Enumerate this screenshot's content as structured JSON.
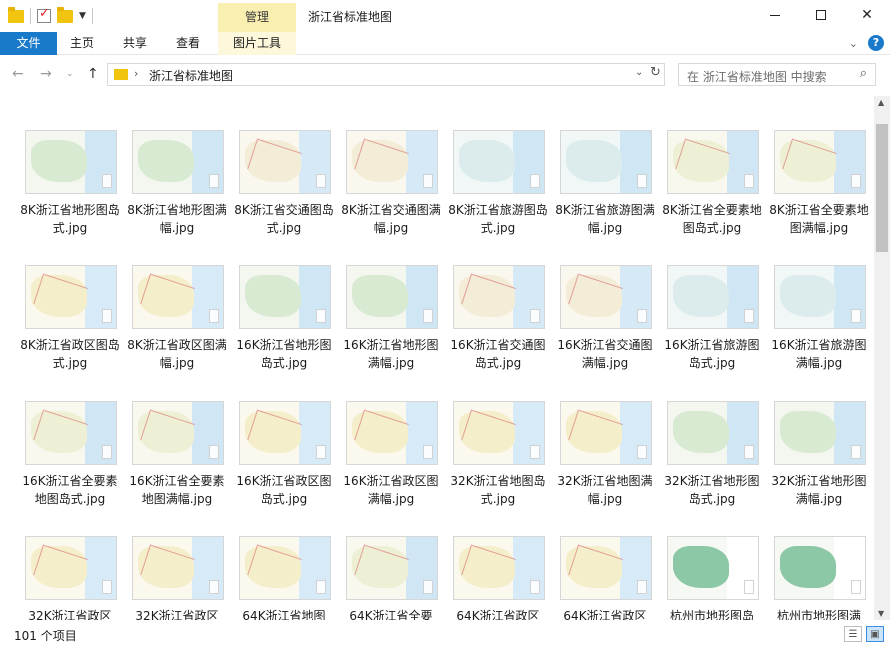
{
  "window": {
    "title": "浙江省标准地图",
    "context_tab": "管理",
    "minimize_icon": "minimize-icon",
    "maximize_icon": "maximize-icon",
    "close_icon": "close-icon"
  },
  "ribbon": {
    "tabs": [
      "文件",
      "主页",
      "共享",
      "查看",
      "图片工具"
    ],
    "help_label": "?"
  },
  "address": {
    "path": "浙江省标准地图",
    "separator": "›",
    "search_placeholder": "在 浙江省标准地图 中搜索"
  },
  "items": [
    {
      "name": "8K浙江省地形图岛式.jpg",
      "style": "terrain"
    },
    {
      "name": "8K浙江省地形图满幅.jpg",
      "style": "terrain"
    },
    {
      "name": "8K浙江省交通图岛式.jpg",
      "style": "traffic"
    },
    {
      "name": "8K浙江省交通图满幅.jpg",
      "style": "traffic"
    },
    {
      "name": "8K浙江省旅游图岛式.jpg",
      "style": "tourism"
    },
    {
      "name": "8K浙江省旅游图满幅.jpg",
      "style": "tourism"
    },
    {
      "name": "8K浙江省全要素地图岛式.jpg",
      "style": "full"
    },
    {
      "name": "8K浙江省全要素地图满幅.jpg",
      "style": "full"
    },
    {
      "name": "8K浙江省政区图岛式.jpg",
      "style": "admin"
    },
    {
      "name": "8K浙江省政区图满幅.jpg",
      "style": "admin"
    },
    {
      "name": "16K浙江省地形图岛式.jpg",
      "style": "terrain"
    },
    {
      "name": "16K浙江省地形图满幅.jpg",
      "style": "terrain"
    },
    {
      "name": "16K浙江省交通图岛式.jpg",
      "style": "traffic"
    },
    {
      "name": "16K浙江省交通图满幅.jpg",
      "style": "traffic"
    },
    {
      "name": "16K浙江省旅游图岛式.jpg",
      "style": "tourism"
    },
    {
      "name": "16K浙江省旅游图满幅.jpg",
      "style": "tourism"
    },
    {
      "name": "16K浙江省全要素地图岛式.jpg",
      "style": "full"
    },
    {
      "name": "16K浙江省全要素地图满幅.jpg",
      "style": "full"
    },
    {
      "name": "16K浙江省政区图岛式.jpg",
      "style": "admin"
    },
    {
      "name": "16K浙江省政区图满幅.jpg",
      "style": "admin"
    },
    {
      "name": "32K浙江省地图岛式.jpg",
      "style": "admin"
    },
    {
      "name": "32K浙江省地图满幅.jpg",
      "style": "admin"
    },
    {
      "name": "32K浙江省地形图岛式.jpg",
      "style": "terrain"
    },
    {
      "name": "32K浙江省地形图满幅.jpg",
      "style": "terrain"
    },
    {
      "name": "32K浙江省政区",
      "style": "admin"
    },
    {
      "name": "32K浙江省政区",
      "style": "admin"
    },
    {
      "name": "64K浙江省地图",
      "style": "admin"
    },
    {
      "name": "64K浙江省全要",
      "style": "full"
    },
    {
      "name": "64K浙江省政区",
      "style": "admin"
    },
    {
      "name": "64K浙江省政区",
      "style": "admin"
    },
    {
      "name": "杭州市地形图岛",
      "style": "hangzhou"
    },
    {
      "name": "杭州市地形图满",
      "style": "hangzhou"
    }
  ],
  "colors": {
    "terrain": {
      "land": "#d9ead3",
      "sea": "#cfe6f5",
      "bg": "#f3f7ef"
    },
    "traffic": {
      "land": "#f3ecd6",
      "sea": "#d6e9f6",
      "bg": "#faf7ee"
    },
    "tourism": {
      "land": "#dcecec",
      "sea": "#cfe6f5",
      "bg": "#f1f7f7"
    },
    "full": {
      "land": "#eef0d6",
      "sea": "#d0e6f5",
      "bg": "#f8f8ee"
    },
    "admin": {
      "land": "#f4eecb",
      "sea": "#d7eaf7",
      "bg": "#fbf9ee"
    },
    "hangzhou": {
      "land": "#8cc7a6",
      "sea": "#ffffff",
      "bg": "#f5f8f3"
    }
  },
  "status": {
    "count": "101 个项目"
  }
}
